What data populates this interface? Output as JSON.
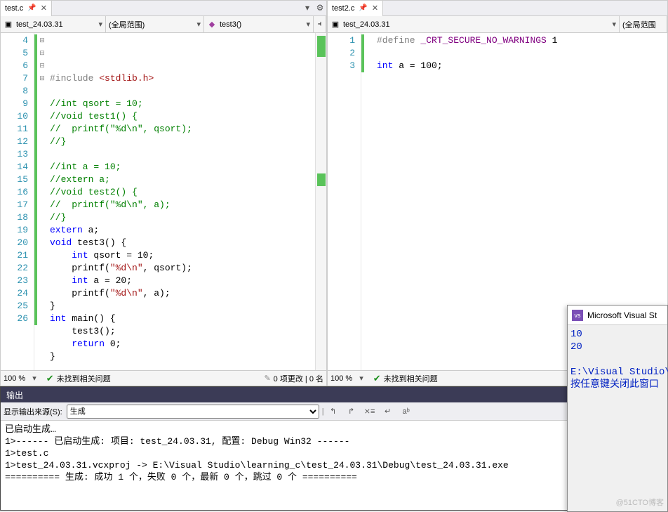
{
  "left": {
    "tab": "test.c",
    "nav_project": "test_24.03.31",
    "nav_scope": "(全局范围)",
    "nav_func": "test3()",
    "lines_start": 4,
    "code": [
      {
        "n": 4,
        "fold": "",
        "html": "<span class='pp'>#include</span> <span class='inc'>&lt;stdlib.h&gt;</span>"
      },
      {
        "n": 5,
        "fold": "",
        "html": ""
      },
      {
        "n": 6,
        "fold": "⊟",
        "html": "<span class='cm'>//int qsort = 10;</span>"
      },
      {
        "n": 7,
        "fold": "",
        "html": "<span class='cm'>//void test1() {</span>"
      },
      {
        "n": 8,
        "fold": "",
        "html": "<span class='cm'>//  printf(\"%d\\n\", qsort);</span>"
      },
      {
        "n": 9,
        "fold": "",
        "html": "<span class='cm'>//}</span>"
      },
      {
        "n": 10,
        "fold": "",
        "html": ""
      },
      {
        "n": 11,
        "fold": "⊟",
        "html": "<span class='cm'>//int a = 10;</span>"
      },
      {
        "n": 12,
        "fold": "",
        "html": "<span class='cm'>//extern a;</span>"
      },
      {
        "n": 13,
        "fold": "",
        "html": "<span class='cm'>//void test2() {</span>"
      },
      {
        "n": 14,
        "fold": "",
        "html": "<span class='cm'>//  printf(\"%d\\n\", a);</span>"
      },
      {
        "n": 15,
        "fold": "",
        "html": "<span class='cm'>//}</span>"
      },
      {
        "n": 16,
        "fold": "",
        "html": "<span class='kw'>extern</span> a;"
      },
      {
        "n": 17,
        "fold": "⊟",
        "html": "<span class='kw'>void</span> test3() {"
      },
      {
        "n": 18,
        "fold": "",
        "html": "    <span class='kw'>int</span> qsort = 10;"
      },
      {
        "n": 19,
        "fold": "",
        "html": "    printf(<span class='str'>\"%d\\n\"</span>, qsort);"
      },
      {
        "n": 20,
        "fold": "",
        "html": "    <span class='kw'>int</span> a = 20;"
      },
      {
        "n": 21,
        "fold": "",
        "html": "    printf(<span class='str'>\"%d\\n\"</span>, a);"
      },
      {
        "n": 22,
        "fold": "",
        "html": "}"
      },
      {
        "n": 23,
        "fold": "⊟",
        "html": "<span class='kw'>int</span> main() {"
      },
      {
        "n": 24,
        "fold": "",
        "html": "    test3();"
      },
      {
        "n": 25,
        "fold": "",
        "html": "    <span class='kw'>return</span> 0;"
      },
      {
        "n": 26,
        "fold": "",
        "html": "}"
      }
    ],
    "zoom": "100 %",
    "status_ok": "未找到相关问题",
    "status_right": "0 项更改 | 0 名"
  },
  "right": {
    "tab": "test2.c",
    "nav_project": "test_24.03.31",
    "nav_scope": "(全局范围",
    "code": [
      {
        "n": 1,
        "fold": "",
        "html": "<span class='pp'>#define</span> <span class='mac'>_CRT_SECURE_NO_WARNINGS</span> 1"
      },
      {
        "n": 2,
        "fold": "",
        "html": ""
      },
      {
        "n": 3,
        "fold": "",
        "html": "<span class='kw'>int</span> a = 100;"
      }
    ],
    "zoom": "100 %",
    "status_ok": "未找到相关问题"
  },
  "output": {
    "title": "输出",
    "source_label": "显示输出来源(S):",
    "source_value": "生成",
    "body": "已启动生成…\n1>------ 已启动生成: 项目: test_24.03.31, 配置: Debug Win32 ------\n1>test.c\n1>test_24.03.31.vcxproj -> E:\\Visual Studio\\learning_c\\test_24.03.31\\Debug\\test_24.03.31.exe\n========== 生成: 成功 1 个，失败 0 个，最新 0 个，跳过 0 个 =========="
  },
  "console": {
    "title": "Microsoft Visual St",
    "lines": [
      "10",
      "20",
      "",
      "E:\\Visual Studio\\",
      "按任意键关闭此窗口"
    ]
  },
  "watermark": "@51CTO博客"
}
